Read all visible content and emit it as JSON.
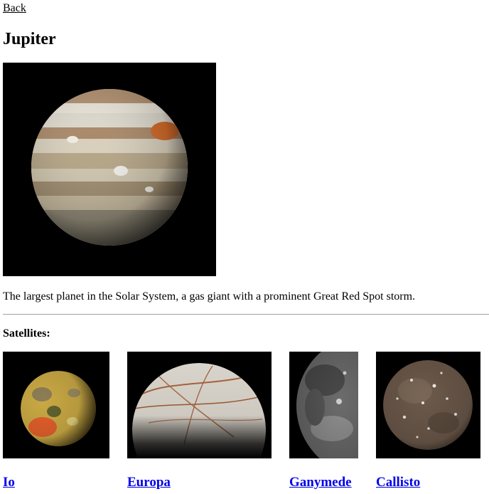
{
  "nav": {
    "back_label": "Back"
  },
  "planet": {
    "name": "Jupiter",
    "description": "The largest planet in the Solar System, a gas giant with a prominent Great Red Spot storm."
  },
  "satellites": {
    "heading": "Satellites:",
    "items": [
      {
        "label": "Io"
      },
      {
        "label": "Europa"
      },
      {
        "label": "Ganymede"
      },
      {
        "label": "Callisto"
      }
    ]
  },
  "colors": {
    "link": "#0000ee",
    "image_background": "#000000",
    "divider": "#a0a0a0"
  }
}
